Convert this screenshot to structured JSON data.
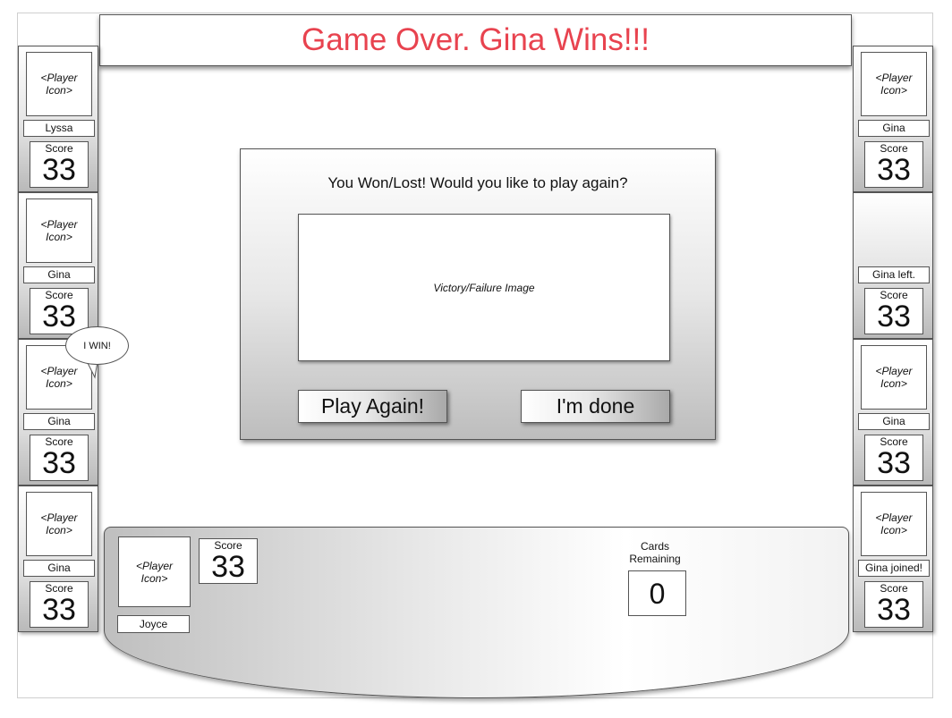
{
  "header": {
    "title": "Game Over.  Gina Wins!!!"
  },
  "left_players": [
    {
      "icon": "<Player\nIcon>",
      "name": "Lyssa",
      "score_label": "Score",
      "score": "33"
    },
    {
      "icon": "<Player\nIcon>",
      "name": "Gina",
      "score_label": "Score",
      "score": "33"
    },
    {
      "icon": "<Player\nIcon>",
      "name": "Gina",
      "score_label": "Score",
      "score": "33"
    },
    {
      "icon": "<Player\nIcon>",
      "name": "Gina",
      "score_label": "Score",
      "score": "33"
    }
  ],
  "right_players": [
    {
      "icon": "<Player\nIcon>",
      "name": "Gina",
      "score_label": "Score",
      "score": "33"
    },
    {
      "icon": null,
      "name": "Gina left.",
      "score_label": "Score",
      "score": "33"
    },
    {
      "icon": "<Player\nIcon>",
      "name": "Gina",
      "score_label": "Score",
      "score": "33"
    },
    {
      "icon": "<Player\nIcon>",
      "name": "Gina joined!",
      "score_label": "Score",
      "score": "33"
    }
  ],
  "speech_bubble": {
    "text": "I WIN!"
  },
  "dialog": {
    "message": "You Won/Lost!  Would you like to play again?",
    "image_placeholder": "Victory/Failure Image",
    "play_again_label": "Play Again!",
    "done_label": "I'm done"
  },
  "bottom": {
    "player": {
      "icon": "<Player\nIcon>",
      "name": "Joyce",
      "score_label": "Score",
      "score": "33"
    },
    "cards_remaining_label": "Cards\nRemaining",
    "cards_remaining": "0"
  },
  "colors": {
    "title": "#e8434f",
    "border": "#555555"
  }
}
